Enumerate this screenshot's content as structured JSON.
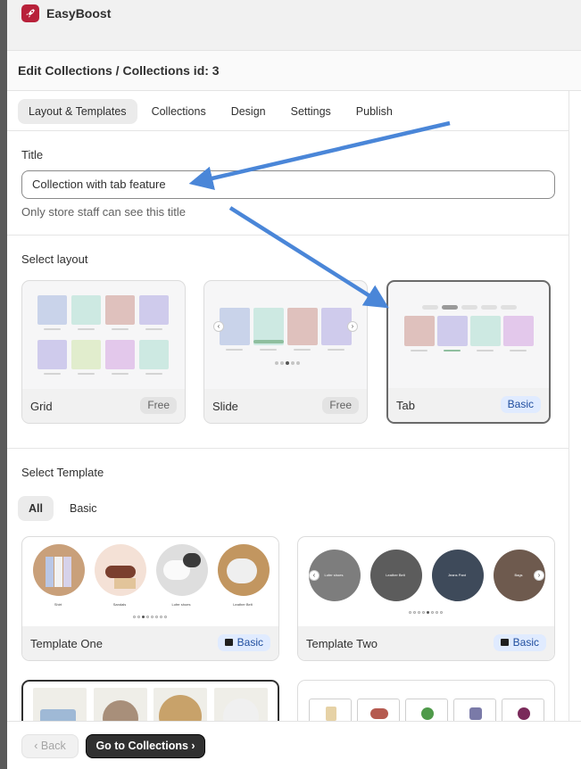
{
  "app": {
    "name": "EasyBoost",
    "brand_color": "#b8213a",
    "logo_icon": "rocket-icon"
  },
  "header": {
    "title": "Edit Collections / Collections id: 3"
  },
  "tabs": [
    {
      "label": "Layout & Templates",
      "active": true
    },
    {
      "label": "Collections",
      "active": false
    },
    {
      "label": "Design",
      "active": false
    },
    {
      "label": "Settings",
      "active": false
    },
    {
      "label": "Publish",
      "active": false
    }
  ],
  "title_field": {
    "label": "Title",
    "value": "Collection with tab feature",
    "help": "Only store staff can see this title"
  },
  "layout": {
    "label": "Select layout",
    "options": [
      {
        "name": "Grid",
        "badge": "Free",
        "selected": false
      },
      {
        "name": "Slide",
        "badge": "Free",
        "selected": false
      },
      {
        "name": "Tab",
        "badge": "Basic",
        "selected": true
      }
    ]
  },
  "template": {
    "label": "Select Template",
    "filters": [
      {
        "label": "All",
        "active": true
      },
      {
        "label": "Basic",
        "active": false
      }
    ],
    "cards": [
      {
        "name": "Template One",
        "badge": "Basic",
        "captions": [
          "Shirt",
          "Sandals",
          "Lofer shoes",
          "Leather Belt"
        ]
      },
      {
        "name": "Template Two",
        "badge": "Basic",
        "captions": [
          "Lofer shoes",
          "Leather Belt",
          "Jeans Pant",
          "Bags"
        ]
      }
    ]
  },
  "footer": {
    "back_label": "Back",
    "go_label": "Go to Collections"
  },
  "colors": {
    "annotation_arrow": "#4a86d8",
    "basic_badge_bg": "#e0ebff",
    "primary_button": "#303030"
  }
}
